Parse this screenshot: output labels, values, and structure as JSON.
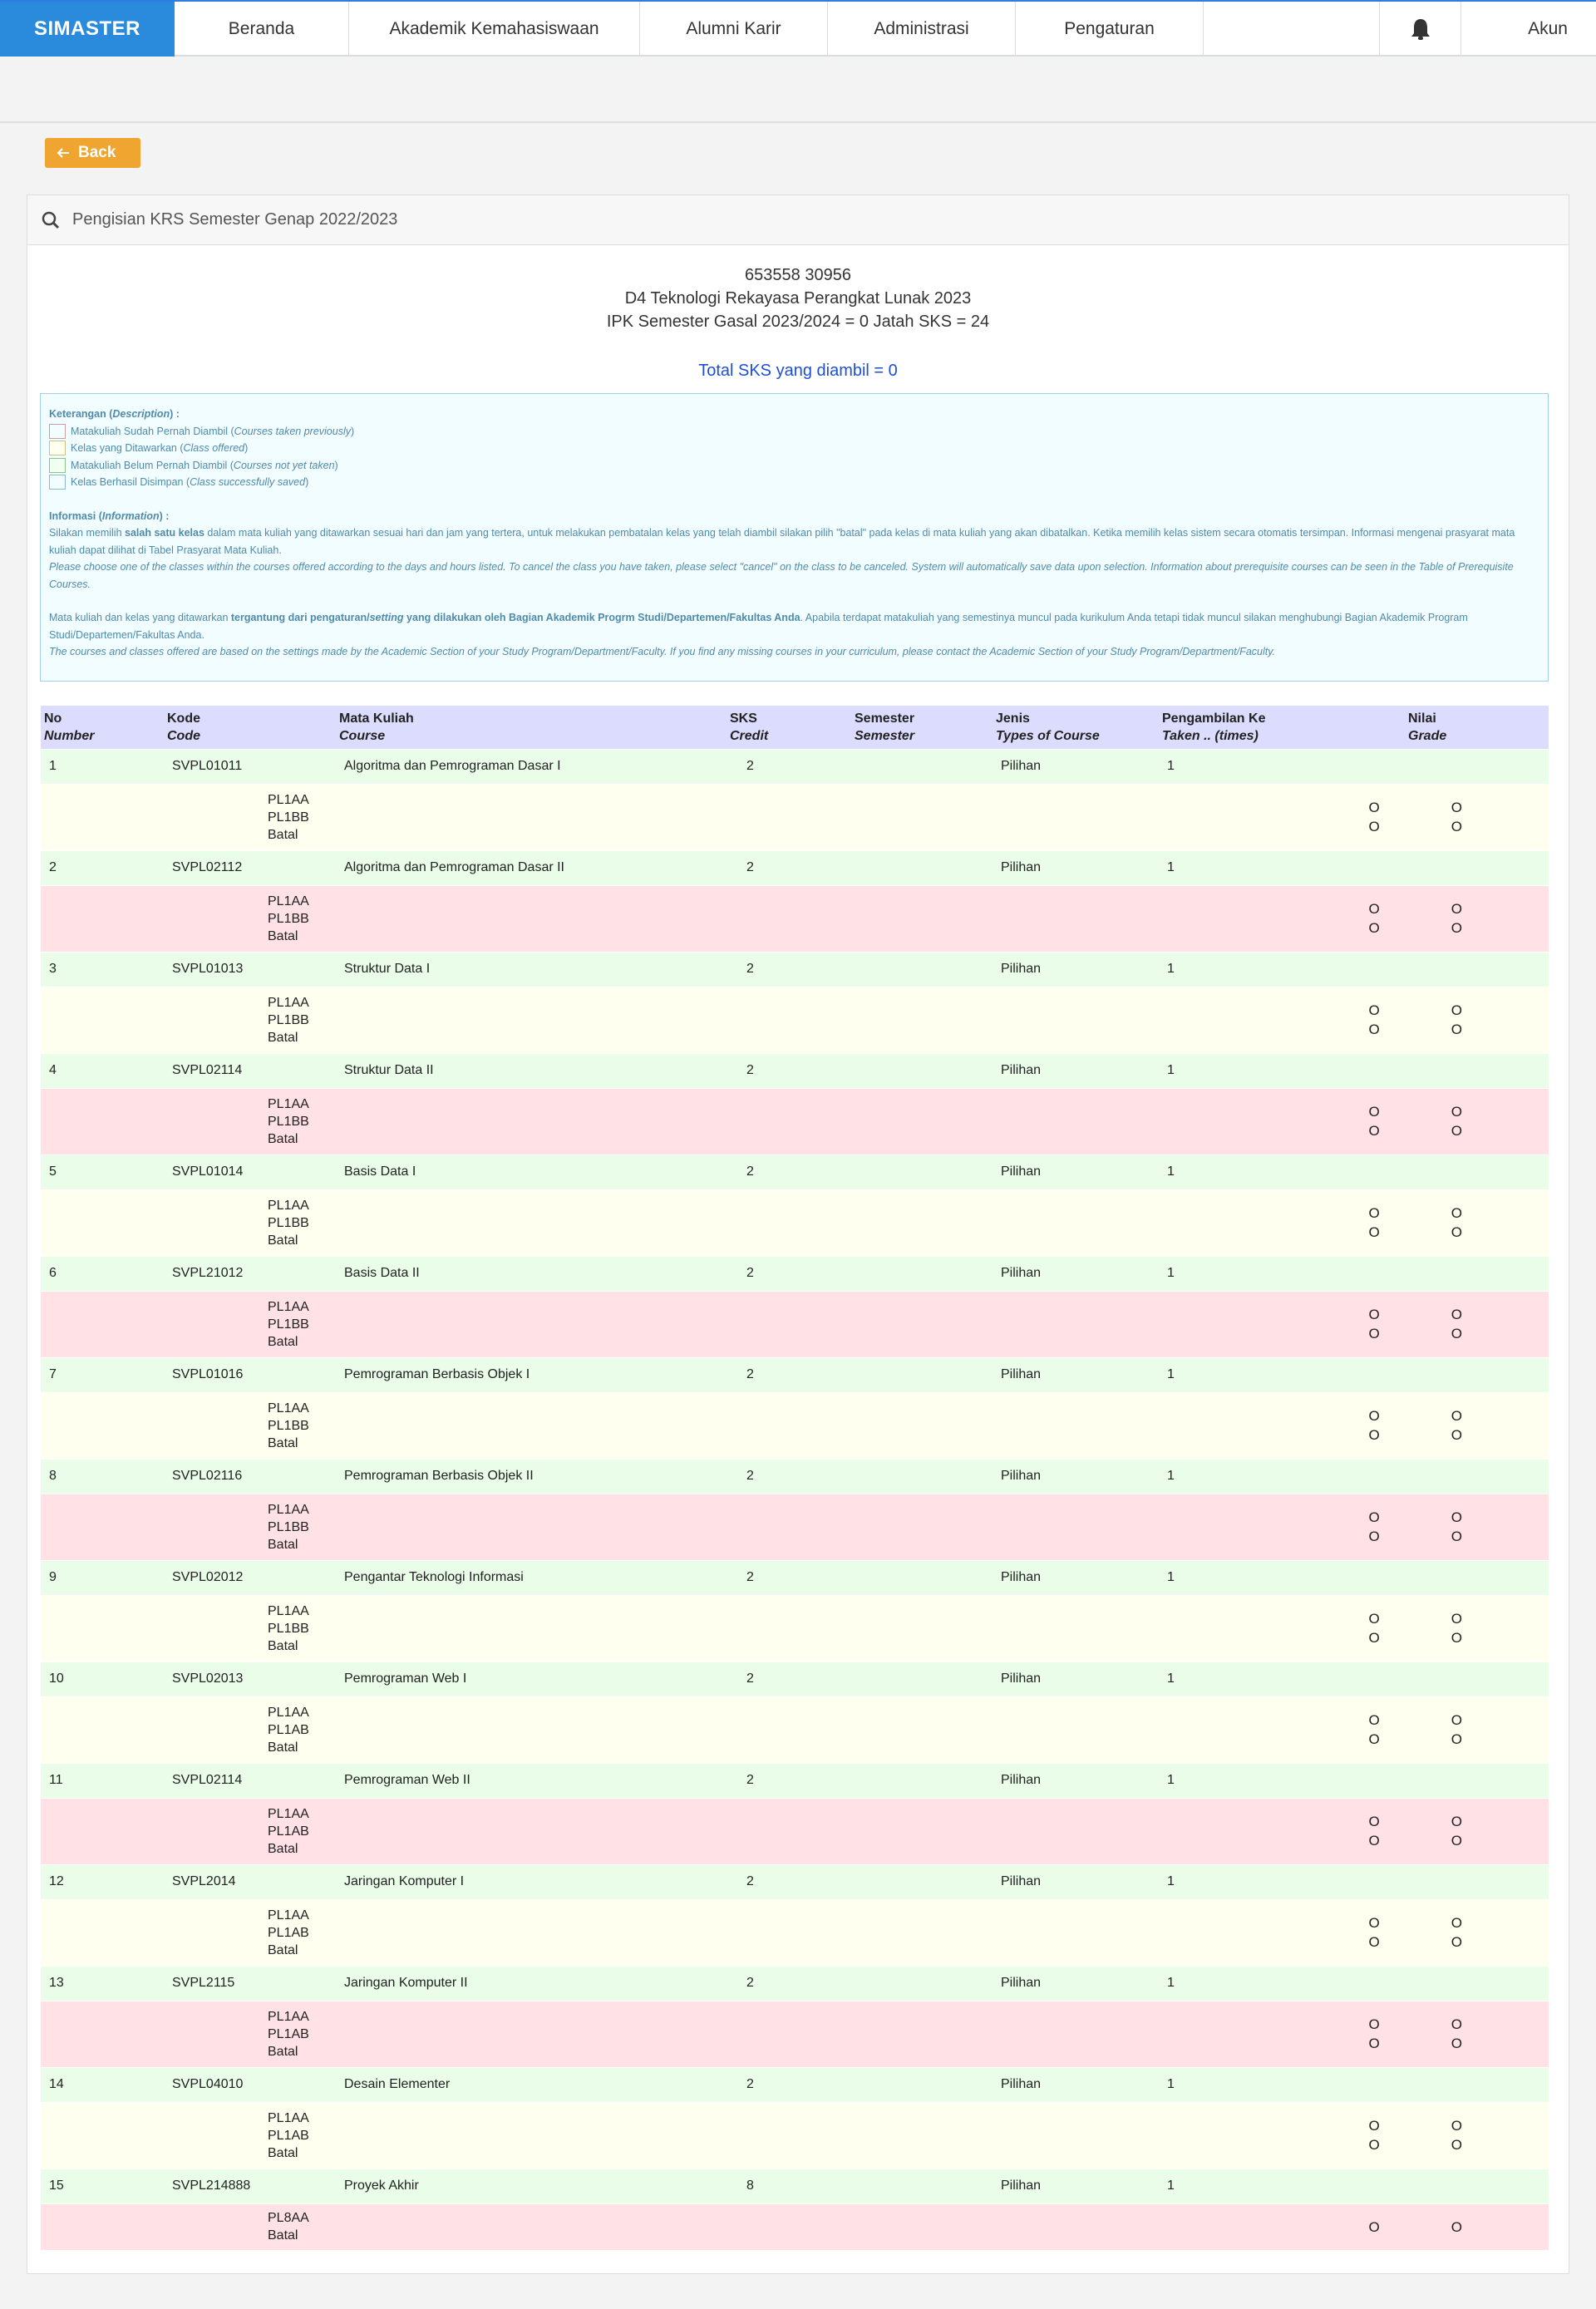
{
  "navbar": {
    "brand": "SIMASTER",
    "items": [
      "Beranda",
      "Akademik Kemahasiswaan",
      "Alumni Karir",
      "Administrasi",
      "Pengaturan"
    ],
    "account": "Akun"
  },
  "back_label": "Back",
  "card": {
    "title": "Pengisian KRS Semester Genap 2022/2023",
    "student_id": "653558 30956",
    "program": "D4 Teknologi Rekayasa Perangkat Lunak 2023",
    "ipk_line": "IPK Semester Gasal 2023/2024 = 0 Jatah SKS = 24",
    "total_sks": "Total SKS yang diambil = 0"
  },
  "legend": {
    "heading_a": "Keterangan (",
    "heading_b": "Description",
    "heading_c": ") :",
    "items": [
      {
        "text": "Matakuliah Sudah Pernah Diambil (",
        "en": "Courses taken previously",
        "end": ")"
      },
      {
        "text": "Kelas yang Ditawarkan (",
        "en": "Class offered",
        "end": ")"
      },
      {
        "text": "Matakuliah Belum Pernah Diambil (",
        "en": "Courses not yet taken",
        "end": ")"
      },
      {
        "text": "Kelas Berhasil Disimpan (",
        "en": "Class successfully saved",
        "end": ")"
      }
    ],
    "info_heading_a": "Informasi (",
    "info_heading_b": "Information",
    "info_heading_c": ") :",
    "info1_a": "Silakan memilih ",
    "info1_b": "salah satu kelas",
    "info1_c": " dalam mata kuliah yang ditawarkan sesuai hari dan jam yang tertera, untuk melakukan pembatalan kelas yang telah diambil silakan pilih \"batal\" pada kelas di mata kuliah yang akan dibatalkan. Ketika memilih kelas sistem secara otomatis tersimpan. Informasi mengenai prasyarat mata kuliah dapat dilihat di Tabel Prasyarat Mata Kuliah.",
    "info1_en": "Please choose one of the classes within the courses offered according to the days and hours listed. To cancel the class you have taken, please select \"cancel\" on the class to be canceled. System will automatically save data upon selection. Information about prerequisite courses can be seen in the Table of Prerequisite Courses.",
    "info2_a": "Mata kuliah dan kelas yang ditawarkan ",
    "info2_b": "tergantung dari pengaturan/",
    "info2_bi": "setting",
    "info2_b2": " yang dilakukan oleh Bagian Akademik Progrm Studi/Departemen/Fakultas Anda",
    "info2_c": ". Apabila terdapat matakuliah yang semestinya muncul pada kurikulum Anda tetapi tidak muncul silakan menghubungi Bagian Akademik Program Studi/Departemen/Fakultas Anda.",
    "info2_en": "The courses and classes offered are based on the settings made by the Academic Section of your Study Program/Department/Faculty. If you find any missing courses in your curriculum, please contact the Academic Section of your Study Program/Department/Faculty."
  },
  "table": {
    "headers": [
      {
        "id": "Number",
        "label": "No",
        "en": "Number"
      },
      {
        "id": "Code",
        "label": "Kode",
        "en": "Code"
      },
      {
        "id": "Course",
        "label": "Mata Kuliah",
        "en": "Course"
      },
      {
        "id": "Credit",
        "label": "SKS",
        "en": "Credit"
      },
      {
        "id": "Semester",
        "label": "Semester",
        "en": "Semester"
      },
      {
        "id": "Type",
        "label": "Jenis",
        "en": "Types of Course"
      },
      {
        "id": "Taken",
        "label": "Pengambilan Ke",
        "en": "Taken .. (times)"
      },
      {
        "id": "Grade",
        "label": "Nilai",
        "en": "Grade"
      }
    ],
    "radio_glyph": "O",
    "rows": [
      {
        "no": "1",
        "code": "SVPL01011",
        "name": "Algoritma dan Pemrograman Dasar I",
        "sks": "2",
        "type": "Pilihan",
        "taken": "1",
        "classes": [
          "PL1AA",
          "PL1BB",
          "Batal"
        ],
        "tone": "y"
      },
      {
        "no": "2",
        "code": "SVPL02112",
        "name": "Algoritma dan Pemrograman Dasar II",
        "sks": "2",
        "type": "Pilihan",
        "taken": "1",
        "classes": [
          "PL1AA",
          "PL1BB",
          "Batal"
        ],
        "tone": "r"
      },
      {
        "no": "3",
        "code": "SVPL01013",
        "name": "Struktur Data I",
        "sks": "2",
        "type": "Pilihan",
        "taken": "1",
        "classes": [
          "PL1AA",
          "PL1BB",
          "Batal"
        ],
        "tone": "y"
      },
      {
        "no": "4",
        "code": "SVPL02114",
        "name": "Struktur Data II",
        "sks": "2",
        "type": "Pilihan",
        "taken": "1",
        "classes": [
          "PL1AA",
          "PL1BB",
          "Batal"
        ],
        "tone": "r"
      },
      {
        "no": "5",
        "code": "SVPL01014",
        "name": "Basis Data I",
        "sks": "2",
        "type": "Pilihan",
        "taken": "1",
        "classes": [
          "PL1AA",
          "PL1BB",
          "Batal"
        ],
        "tone": "y"
      },
      {
        "no": "6",
        "code": "SVPL21012",
        "name": "Basis Data II",
        "sks": "2",
        "type": "Pilihan",
        "taken": "1",
        "classes": [
          "PL1AA",
          "PL1BB",
          "Batal"
        ],
        "tone": "r"
      },
      {
        "no": "7",
        "code": "SVPL01016",
        "name": "Pemrograman Berbasis Objek I",
        "sks": "2",
        "type": "Pilihan",
        "taken": "1",
        "classes": [
          "PL1AA",
          "PL1BB",
          "Batal"
        ],
        "tone": "y"
      },
      {
        "no": "8",
        "code": "SVPL02116",
        "name": "Pemrograman Berbasis Objek II",
        "sks": "2",
        "type": "Pilihan",
        "taken": "1",
        "classes": [
          "PL1AA",
          "PL1BB",
          "Batal"
        ],
        "tone": "r"
      },
      {
        "no": "9",
        "code": "SVPL02012",
        "name": "Pengantar Teknologi Informasi",
        "sks": "2",
        "type": "Pilihan",
        "taken": "1",
        "classes": [
          "PL1AA",
          "PL1BB",
          "Batal"
        ],
        "tone": "y"
      },
      {
        "no": "10",
        "code": "SVPL02013",
        "name": "Pemrograman Web I",
        "sks": "2",
        "type": "Pilihan",
        "taken": "1",
        "classes": [
          "PL1AA",
          "PL1AB",
          "Batal"
        ],
        "tone": "y"
      },
      {
        "no": "11",
        "code": "SVPL02114",
        "name": "Pemrograman Web II",
        "sks": "2",
        "type": "Pilihan",
        "taken": "1",
        "classes": [
          "PL1AA",
          "PL1AB",
          "Batal"
        ],
        "tone": "r"
      },
      {
        "no": "12",
        "code": "SVPL2014",
        "name": "Jaringan Komputer I",
        "sks": "2",
        "type": "Pilihan",
        "taken": "1",
        "classes": [
          "PL1AA",
          "PL1AB",
          "Batal"
        ],
        "tone": "y"
      },
      {
        "no": "13",
        "code": "SVPL2115",
        "name": "Jaringan Komputer II",
        "sks": "2",
        "type": "Pilihan",
        "taken": "1",
        "classes": [
          "PL1AA",
          "PL1AB",
          "Batal"
        ],
        "tone": "r"
      },
      {
        "no": "14",
        "code": "SVPL04010",
        "name": "Desain Elementer",
        "sks": "2",
        "type": "Pilihan",
        "taken": "1",
        "classes": [
          "PL1AA",
          "PL1AB",
          "Batal"
        ],
        "tone": "y"
      },
      {
        "no": "15",
        "code": "SVPL214888",
        "name": "Proyek Akhir",
        "sks": "8",
        "type": "Pilihan",
        "taken": "1",
        "classes": [
          "PL8AA",
          "Batal"
        ],
        "tone": "r"
      }
    ]
  },
  "colors": {
    "brand": "#2a8bdc",
    "back_button": "#f0a530",
    "header_row": "#dcdcff",
    "course_row": "#e9fde9",
    "class_offered": "#fffff0",
    "class_taken": "#ffe1e6",
    "total_text": "#1d4fd6"
  },
  "icons": [
    "bell-icon",
    "search-icon",
    "arrow-left-icon"
  ]
}
